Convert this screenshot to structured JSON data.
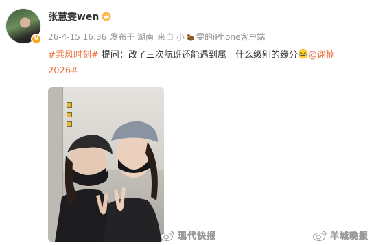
{
  "user": {
    "name": "张慧雯wen",
    "verified_badge": "V",
    "avatar_icon": "user-avatar",
    "member_icon": "crown-icon"
  },
  "meta": {
    "timestamp": "26-4-15 16:36",
    "posted_from": "发布于 湖南",
    "source_prefix": "来自 小",
    "source_suffix": "雯的iPhone客户端",
    "source_icon": "pet-icon"
  },
  "post": {
    "topic": "#乘风时刻#",
    "body": " 提问：改了三次航班还能遇到属于什么级别的缘分",
    "emoji_icon": "laughing-tears-emoji",
    "mention": "@谢楠",
    "topic2": "2026#"
  },
  "watermarks": {
    "left": "现代快报",
    "right": "羊城晚报"
  },
  "colors": {
    "accent": "#eb7340",
    "meta": "#939393",
    "badge": "#f7a823"
  }
}
